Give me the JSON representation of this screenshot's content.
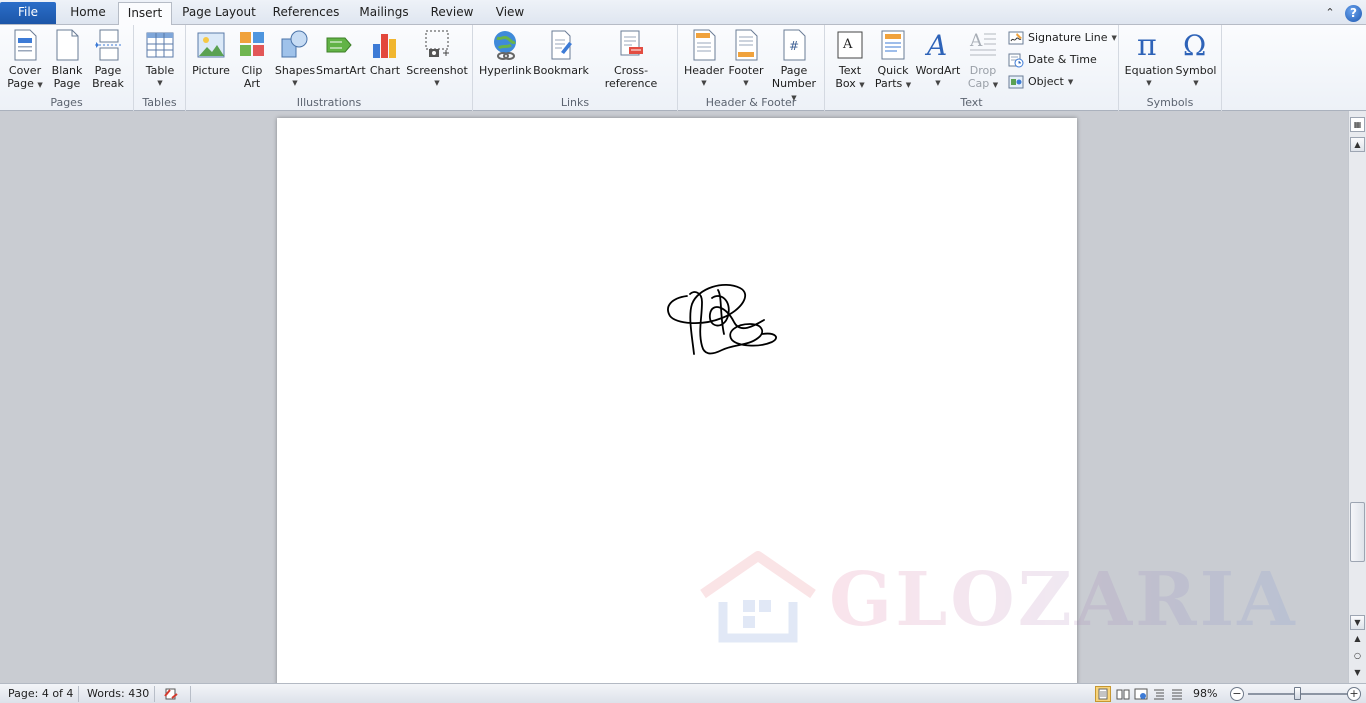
{
  "tabs": {
    "file": "File",
    "home": "Home",
    "insert": "Insert",
    "page_layout": "Page Layout",
    "references": "References",
    "mailings": "Mailings",
    "review": "Review",
    "view": "View"
  },
  "ribbon": {
    "pages": {
      "label": "Pages",
      "cover_page": [
        "Cover",
        "Page"
      ],
      "blank_page": [
        "Blank",
        "Page"
      ],
      "page_break": [
        "Page",
        "Break"
      ]
    },
    "tables": {
      "label": "Tables",
      "table": "Table"
    },
    "illustrations": {
      "label": "Illustrations",
      "picture": "Picture",
      "clip_art": [
        "Clip",
        "Art"
      ],
      "shapes": "Shapes",
      "smartart": "SmartArt",
      "chart": "Chart",
      "screenshot": "Screenshot"
    },
    "links": {
      "label": "Links",
      "hyperlink": "Hyperlink",
      "bookmark": "Bookmark",
      "cross_reference": "Cross-reference"
    },
    "header_footer": {
      "label": "Header & Footer",
      "header": "Header",
      "footer": "Footer",
      "page_number": [
        "Page",
        "Number"
      ]
    },
    "text": {
      "label": "Text",
      "text_box": [
        "Text",
        "Box"
      ],
      "quick_parts": [
        "Quick",
        "Parts"
      ],
      "wordart": "WordArt",
      "drop_cap": [
        "Drop",
        "Cap"
      ],
      "signature_line": "Signature Line",
      "date_time": "Date & Time",
      "object": "Object"
    },
    "symbols": {
      "label": "Symbols",
      "equation": "Equation",
      "symbol": "Symbol"
    }
  },
  "document": {
    "watermark_text": "GLOZARIA"
  },
  "status": {
    "page": "Page: 4 of 4",
    "words": "Words: 430",
    "zoom": "98%",
    "zoom_percent": 98
  }
}
